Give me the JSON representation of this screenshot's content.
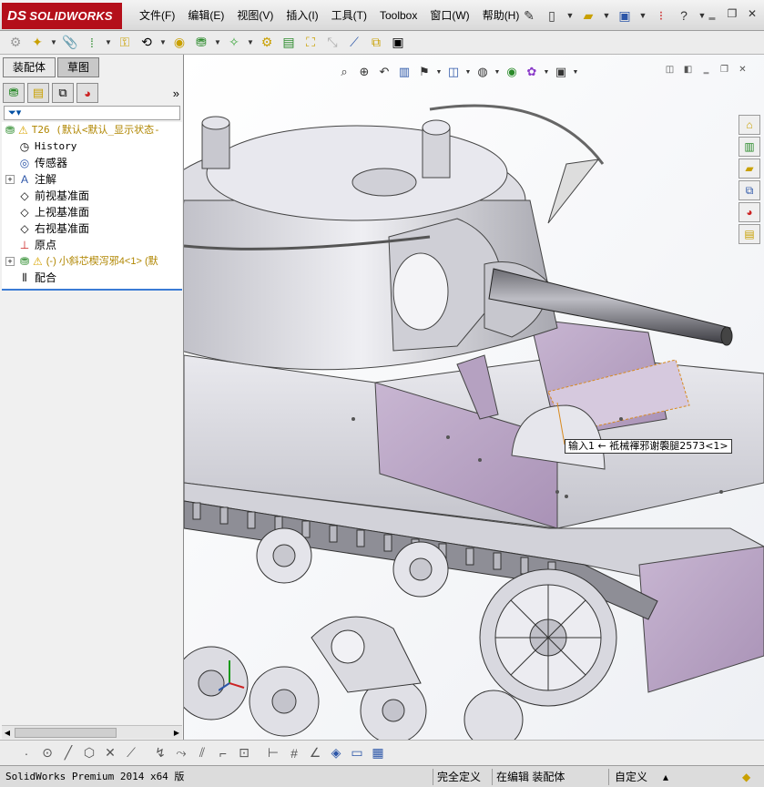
{
  "app": {
    "logo_text": "SOLIDWORKS",
    "logo_prefix": "DS"
  },
  "menu": {
    "items": [
      "文件(F)",
      "编辑(E)",
      "视图(V)",
      "插入(I)",
      "工具(T)",
      "Toolbox",
      "窗口(W)",
      "帮助(H)"
    ]
  },
  "left_panel": {
    "tabs": [
      "装配体",
      "草图"
    ],
    "active_tab": "装配体",
    "expand_glyph": "»",
    "tree": {
      "root_label": "T26  (默认<默认_显示状态-",
      "items": [
        {
          "label": "History",
          "icon": "history-icon"
        },
        {
          "label": "传感器",
          "icon": "sensor-icon"
        },
        {
          "label": "注解",
          "icon": "annotation-icon"
        },
        {
          "label": "前视基准面",
          "icon": "plane-icon"
        },
        {
          "label": "上视基准面",
          "icon": "plane-icon"
        },
        {
          "label": "右视基准面",
          "icon": "plane-icon"
        },
        {
          "label": "原点",
          "icon": "origin-icon"
        },
        {
          "label": "(-) 小斜芯楔泻邪4<1> (默",
          "icon": "subassembly-icon"
        },
        {
          "label": "配合",
          "icon": "mate-icon"
        }
      ]
    }
  },
  "viewport": {
    "callout_text": "输入1 ← 袛械褌邪谢褜腿2573<1>"
  },
  "status_bar": {
    "version": "SolidWorks Premium 2014 x64 版",
    "fully_defined": "完全定义",
    "editing": "在编辑 装配体",
    "custom": "自定义",
    "caret": "▴"
  },
  "colors": {
    "logo_bg": "#b40f1a",
    "accent_blue": "#3a7bd5",
    "tank_purple": "#b9a6c4",
    "tank_grey": "#cfcfd6"
  }
}
